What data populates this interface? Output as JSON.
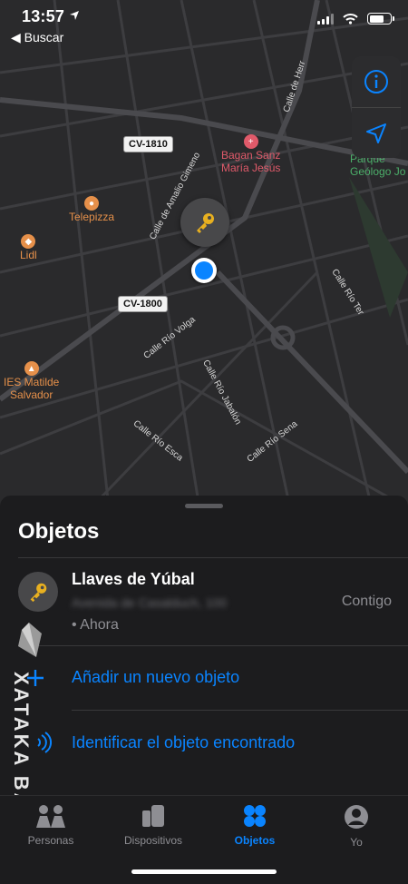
{
  "status_bar": {
    "time": "13:57",
    "back_label": "◀ Buscar"
  },
  "map": {
    "road_badges": [
      "CV-1810",
      "CV-1800"
    ],
    "pois": [
      {
        "name": "Telepizza",
        "color": "#e6904a"
      },
      {
        "name": "Lidl",
        "color": "#e6904a"
      },
      {
        "name": "Bagan Sanz\nMaría Jesús",
        "color": "#e05a6a"
      },
      {
        "name": "IES Matilde\nSalvador",
        "color": "#e6904a"
      },
      {
        "name": "Parque\nGeólogo Jo",
        "color": "#4caf6a"
      }
    ],
    "streets": [
      "Calle de Amalio Gimeno",
      "Calle de Herr",
      "Calle Río Volga",
      "Calle Río Jabalón",
      "Calle Río Esca",
      "Calle Río Sena",
      "Calle Río Ter"
    ]
  },
  "sheet": {
    "title": "Objetos",
    "item": {
      "name": "Llaves de Yúbal",
      "address": "Avenida de Casalduch, 100",
      "time": "• Ahora",
      "status": "Contigo",
      "icon": "key-icon"
    },
    "actions": [
      {
        "label": "Añadir un nuevo objeto",
        "icon": "plus-icon"
      },
      {
        "label": "Identificar el objeto encontrado",
        "icon": "signal-icon"
      }
    ]
  },
  "watermark": {
    "text": "XATAKA BASICS"
  },
  "tabs": [
    {
      "label": "Personas",
      "icon": "people-icon",
      "active": false
    },
    {
      "label": "Dispositivos",
      "icon": "devices-icon",
      "active": false
    },
    {
      "label": "Objetos",
      "icon": "objects-icon",
      "active": true
    },
    {
      "label": "Yo",
      "icon": "person-icon",
      "active": false
    }
  ],
  "colors": {
    "accent": "#0a84ff",
    "background": "#1c1c1e",
    "map": "#2a2a2c"
  }
}
